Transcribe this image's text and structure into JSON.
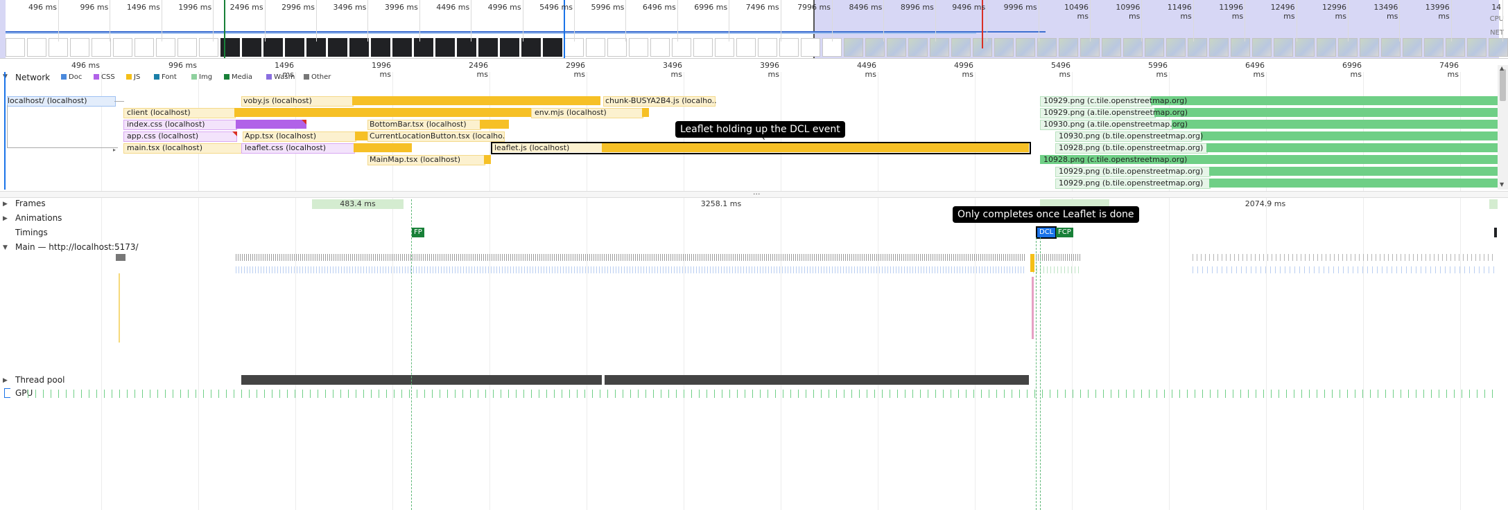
{
  "overview": {
    "ruler_labels": [
      "496 ms",
      "996 ms",
      "1496 ms",
      "1996 ms",
      "2496 ms",
      "2996 ms",
      "3496 ms",
      "3996 ms",
      "4496 ms",
      "4996 ms",
      "5496 ms",
      "5996 ms",
      "6496 ms",
      "6996 ms",
      "7496 ms",
      "7996 ms",
      "8496 ms",
      "8996 ms",
      "9496 ms",
      "9996 ms",
      "10496 ms",
      "10996 ms",
      "11496 ms",
      "11996 ms",
      "12496 ms",
      "12996 ms",
      "13496 ms",
      "13996 ms",
      "14"
    ],
    "cpu_label": "CPU",
    "net_label": "NET"
  },
  "ruler": {
    "labels": [
      "496 ms",
      "996 ms",
      "1496 ms",
      "1996 ms",
      "2496 ms",
      "2996 ms",
      "3496 ms",
      "3996 ms",
      "4496 ms",
      "4996 ms",
      "5496 ms",
      "5996 ms",
      "6496 ms",
      "6996 ms",
      "7496 ms"
    ]
  },
  "network": {
    "title": "Network",
    "legend": [
      {
        "label": "Doc",
        "color": "#4a89dc"
      },
      {
        "label": "CSS",
        "color": "#b162e8"
      },
      {
        "label": "JS",
        "color": "#f4bf18"
      },
      {
        "label": "Font",
        "color": "#1a7fa8"
      },
      {
        "label": "Img",
        "color": "#8fd19e"
      },
      {
        "label": "Media",
        "color": "#188038"
      },
      {
        "label": "Wasm",
        "color": "#8a6fe0"
      },
      {
        "label": "Other",
        "color": "#777777"
      }
    ],
    "requests": {
      "doc": "localhost/ (localhost)",
      "voby": "voby.js (localhost)",
      "chunk": "chunk-BUSYA2B4.js (localho...",
      "client": "client (localhost)",
      "env": "env.mjs (localhost)",
      "indexcss": "index.css (localhost)",
      "bottombar": "BottomBar.tsx (localhost)",
      "appcss": "app.css (localhost)",
      "apptsx": "App.tsx (localhost)",
      "currentloc": "CurrentLocationButton.tsx (localho...",
      "maintsx": "main.tsx (localhost)",
      "leafletcss": "leaflet.css (localhost)",
      "leafletjs": "leaflet.js (localhost)",
      "mainmap": "MainMap.tsx (localhost)",
      "tile1": "10929.png (c.tile.openstreetmap.org)",
      "tile2": "10929.png (a.tile.openstreetmap.org)",
      "tile3": "10930.png (a.tile.openstreetmap.org)",
      "tile4": "10930.png (b.tile.openstreetmap.org)",
      "tile5": "10928.png (b.tile.openstreetmap.org)",
      "tile6": "10928.png (c.tile.openstreetmap.org)",
      "tile7": "10929.png (b.tile.openstreetmap.org)",
      "tile8": "10929.png (b.tile.openstreetmap.org)"
    },
    "more": "..."
  },
  "annotations": {
    "leaflet": "Leaflet holding up the DCL event",
    "dcl": "Only completes once Leaflet is done"
  },
  "tracks": {
    "frames": "Frames",
    "frame_durations": [
      "483.4 ms",
      "3258.1 ms",
      "2074.9 ms"
    ],
    "animations": "Animations",
    "timings": "Timings",
    "fp": "FP",
    "dcl": "DCL",
    "fcp": "FCP",
    "main": "Main — http://localhost:5173/",
    "thread_pool": "Thread pool",
    "gpu": "GPU"
  }
}
